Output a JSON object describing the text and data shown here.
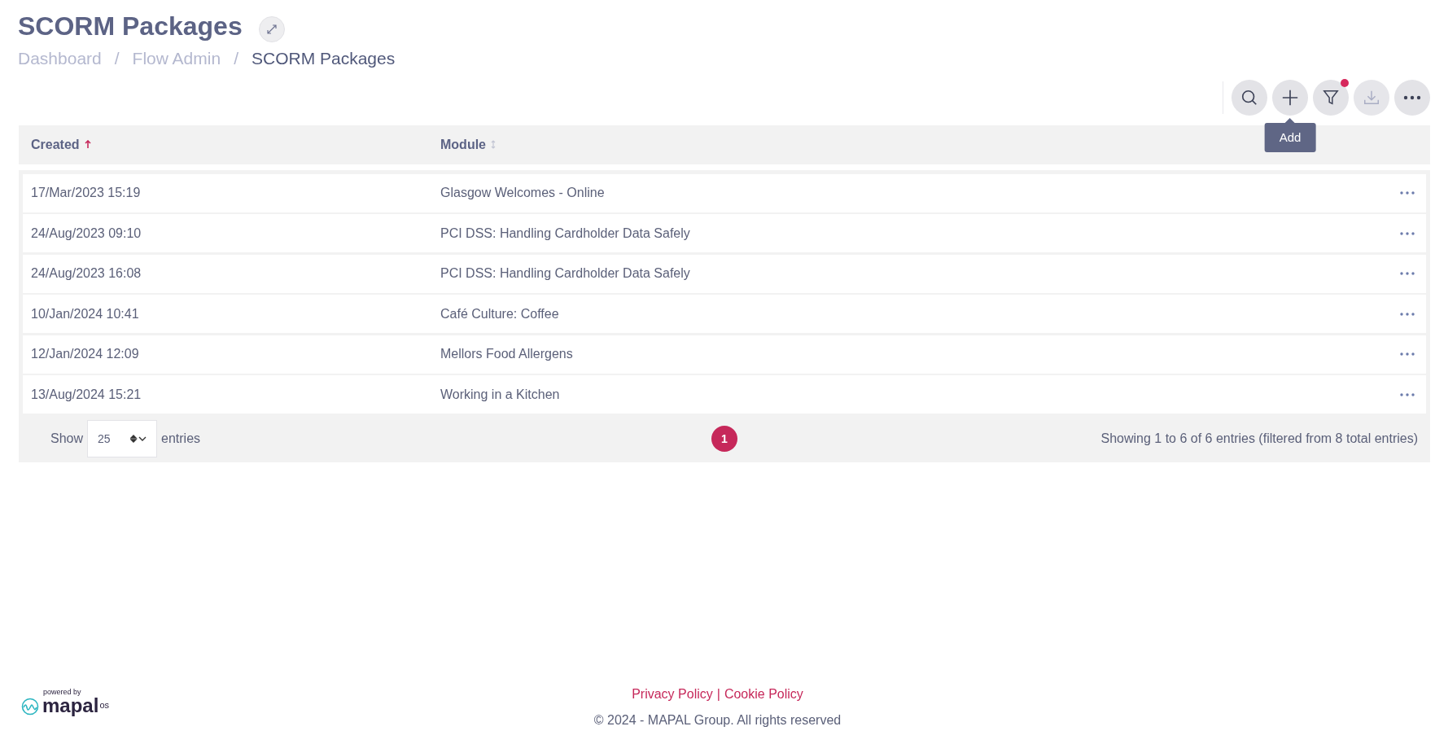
{
  "page": {
    "title": "SCORM Packages"
  },
  "breadcrumb": [
    {
      "label": "Dashboard",
      "current": false
    },
    {
      "label": "Flow Admin",
      "current": false
    },
    {
      "label": "SCORM Packages",
      "current": true
    }
  ],
  "breadcrumb_separator": "/",
  "toolbar": [
    {
      "kind": "search",
      "disabled": false,
      "indicator": false
    },
    {
      "kind": "add",
      "disabled": false,
      "indicator": false
    },
    {
      "kind": "filter",
      "disabled": false,
      "indicator": true
    },
    {
      "kind": "download",
      "disabled": true,
      "indicator": false
    },
    {
      "kind": "more",
      "disabled": false,
      "indicator": false
    }
  ],
  "tooltip": {
    "text": "Add"
  },
  "table": {
    "columns": [
      {
        "label": "Created",
        "sorted": true
      },
      {
        "label": "Module",
        "sorted": false
      }
    ],
    "rows": [
      {
        "created": "17/Mar/2023 15:19",
        "module": "Glasgow Welcomes - Online"
      },
      {
        "created": "24/Aug/2023 09:10",
        "module": "PCI DSS: Handling Cardholder Data Safely"
      },
      {
        "created": "24/Aug/2023 16:08",
        "module": "PCI DSS: Handling Cardholder Data Safely"
      },
      {
        "created": "10/Jan/2024 10:41",
        "module": "Café Culture: Coffee"
      },
      {
        "created": "12/Jan/2024 12:09",
        "module": "Mellors Food Allergens"
      },
      {
        "created": "13/Aug/2024 15:21",
        "module": "Working in a Kitchen"
      }
    ]
  },
  "table_footer": {
    "show_label": "Show",
    "page_size": "25",
    "entries_label": "entries",
    "pages": [
      {
        "label": "1",
        "selected": true
      }
    ],
    "summary": "Showing 1 to 6 of 6 entries (filtered from 8 total entries)"
  },
  "footer": {
    "powered_by": "powered by",
    "brand": "mapal",
    "brand_suffix": "os",
    "links": [
      {
        "label": "Privacy Policy"
      },
      {
        "label": "Cookie Policy"
      }
    ],
    "link_separator": "|",
    "copyright": "© 2024 - MAPAL Group. All rights reserved"
  }
}
